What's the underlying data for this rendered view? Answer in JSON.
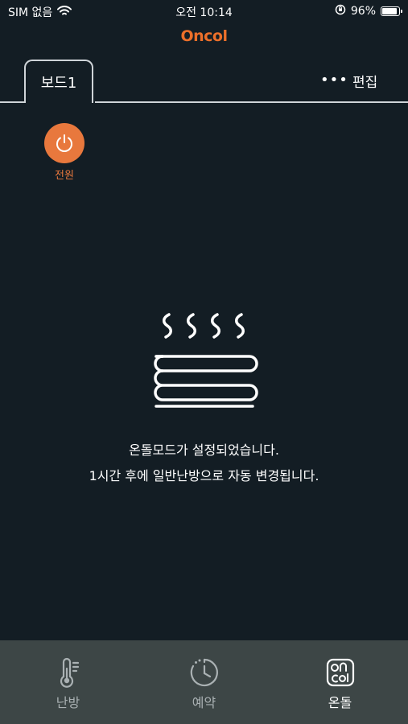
{
  "status_bar": {
    "carrier": "SIM 없음",
    "time": "오전 10:14",
    "battery": "96%",
    "battery_level": 0.96
  },
  "header": {
    "logo": "Oncol"
  },
  "tabs": {
    "active_tab": "보드1",
    "more": "•••",
    "edit": "편집"
  },
  "power": {
    "label": "전원"
  },
  "main": {
    "message_line1": "온돌모드가 설정되었습니다.",
    "message_line2": "1시간 후에 일반난방으로 자동 변경됩니다."
  },
  "bottom_nav": {
    "items": [
      {
        "label": "난방",
        "icon": "thermometer-icon",
        "active": false
      },
      {
        "label": "예약",
        "icon": "clock-icon",
        "active": false
      },
      {
        "label": "온돌",
        "icon": "ondol-icon",
        "active": true
      }
    ]
  },
  "colors": {
    "background": "#131d24",
    "accent": "#e8783d",
    "nav_background": "#3d4646"
  }
}
